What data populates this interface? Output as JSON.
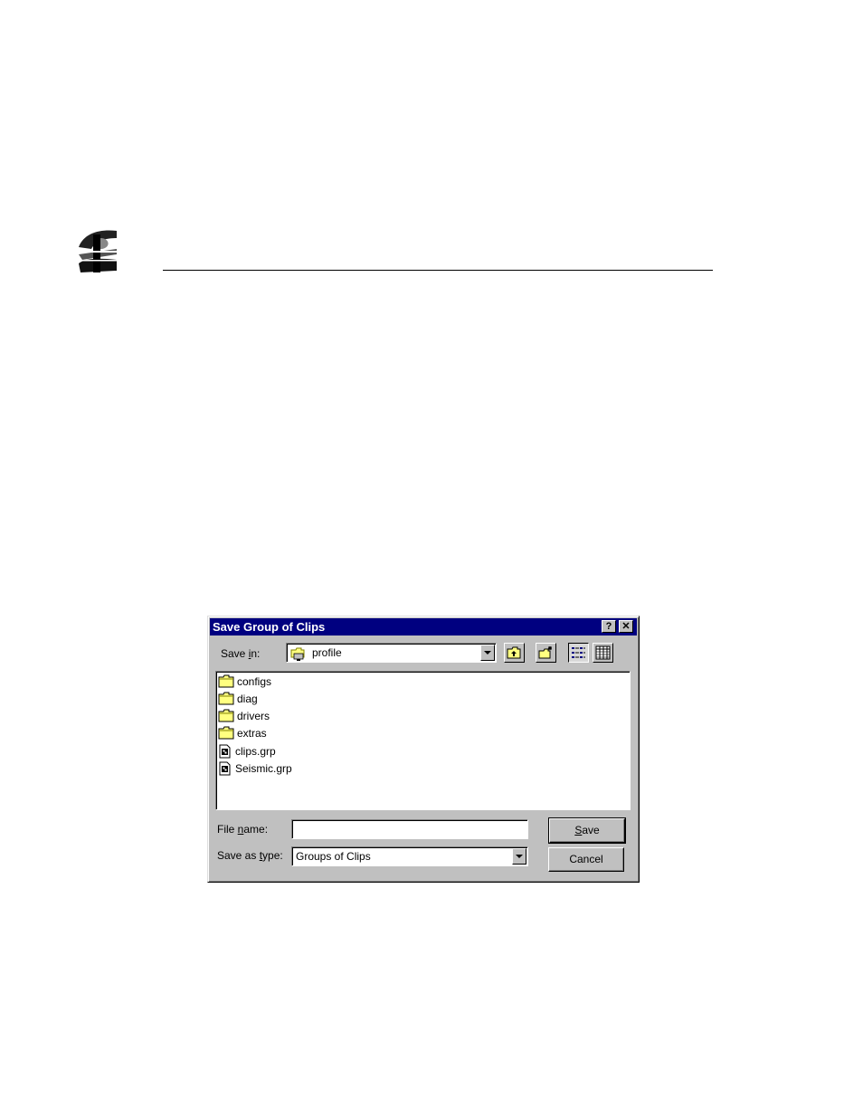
{
  "dialog": {
    "title": "Save Group of Clips",
    "help_button": "?",
    "close_button": "✕",
    "save_in": {
      "label_pre": "Save ",
      "label_accel": "i",
      "label_post": "n:",
      "value": "profile"
    },
    "toolbar": {
      "up_one_level": "up-folder-icon",
      "new_folder": "new-folder-icon",
      "list_view": "list-view-icon",
      "details_view": "details-view-icon"
    },
    "files": [
      {
        "name": "configs",
        "type": "folder"
      },
      {
        "name": "diag",
        "type": "folder"
      },
      {
        "name": "drivers",
        "type": "folder"
      },
      {
        "name": "extras",
        "type": "folder"
      },
      {
        "name": "clips.grp",
        "type": "file"
      },
      {
        "name": "Seismic.grp",
        "type": "file"
      }
    ],
    "file_name": {
      "label_pre": "File ",
      "label_accel": "n",
      "label_post": "ame:",
      "value": ""
    },
    "save_as_type": {
      "label_pre": "Save as ",
      "label_accel": "t",
      "label_post": "ype:",
      "value": "Groups of Clips"
    },
    "save_button": {
      "accel": "S",
      "rest": "ave"
    },
    "cancel_button": "Cancel"
  },
  "colors": {
    "title_bar": "#000080",
    "dialog_face": "#c0c0c0",
    "folder": "#ffff80"
  }
}
